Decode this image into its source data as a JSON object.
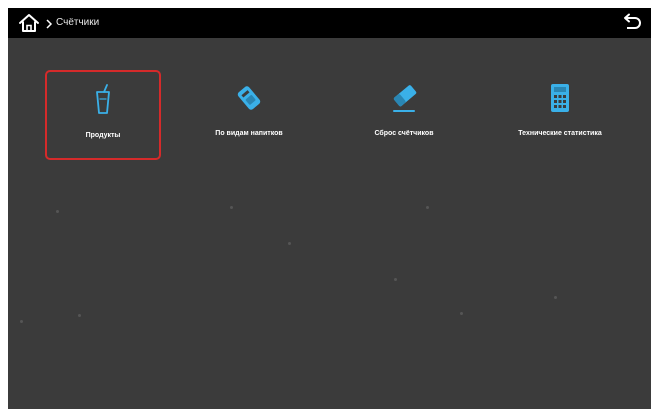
{
  "colors": {
    "background": "#3b3b3b",
    "topbar": "#000000",
    "accent": "#3ab0e8",
    "selection": "#d52a2a"
  },
  "topbar": {
    "home_icon": "home-icon",
    "separator_icon": "chevron-right-icon",
    "breadcrumb": "Счётчики",
    "back_icon": "back-arrow-icon"
  },
  "tiles": [
    {
      "label": "Продукты",
      "icon": "cup-icon",
      "selected": true
    },
    {
      "label": "По видам напитков",
      "icon": "drink-tag-icon",
      "selected": false
    },
    {
      "label": "Сброс счётчиков",
      "icon": "eraser-icon",
      "selected": false
    },
    {
      "label": "Технические статистика",
      "icon": "calculator-icon",
      "selected": false
    }
  ]
}
